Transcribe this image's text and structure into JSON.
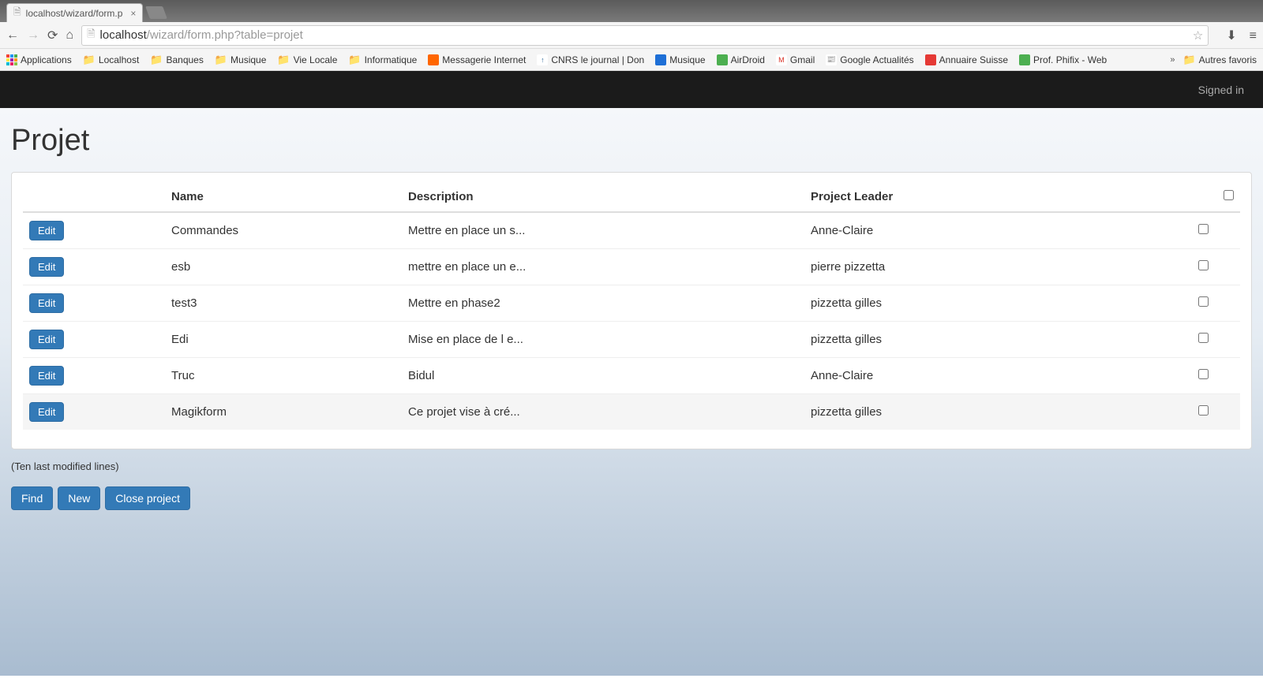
{
  "browser": {
    "tab_title": "localhost/wizard/form.p",
    "url_host": "localhost",
    "url_path": "/wizard/form.php?table=projet"
  },
  "bookmarks": {
    "apps": "Applications",
    "items": [
      "Localhost",
      "Banques",
      "Musique",
      "Vie Locale",
      "Informatique",
      "Messagerie Internet",
      "CNRS le journal | Don",
      "Musique",
      "AirDroid",
      "Gmail",
      "Google Actualités",
      "Annuaire Suisse",
      "Prof. Phifix - Web"
    ],
    "other": "Autres favoris"
  },
  "header": {
    "signed_in": "Signed in"
  },
  "page": {
    "title": "Projet",
    "columns": {
      "name": "Name",
      "description": "Description",
      "leader": "Project Leader"
    },
    "rows": [
      {
        "edit": "Edit",
        "name": "Commandes",
        "desc": "Mettre en place un s...",
        "leader": "Anne-Claire"
      },
      {
        "edit": "Edit",
        "name": "esb",
        "desc": "mettre en place un e...",
        "leader": "pierre pizzetta"
      },
      {
        "edit": "Edit",
        "name": "test3",
        "desc": "Mettre en phase2",
        "leader": "pizzetta gilles"
      },
      {
        "edit": "Edit",
        "name": "Edi",
        "desc": "Mise en place de l e...",
        "leader": "pizzetta gilles"
      },
      {
        "edit": "Edit",
        "name": "Truc",
        "desc": "Bidul",
        "leader": "Anne-Claire"
      },
      {
        "edit": "Edit",
        "name": "Magikform",
        "desc": "Ce projet vise à cré...",
        "leader": "pizzetta gilles"
      }
    ],
    "footer_note": "(Ten last modified lines)",
    "buttons": {
      "find": "Find",
      "new": "New",
      "close": "Close project"
    }
  }
}
